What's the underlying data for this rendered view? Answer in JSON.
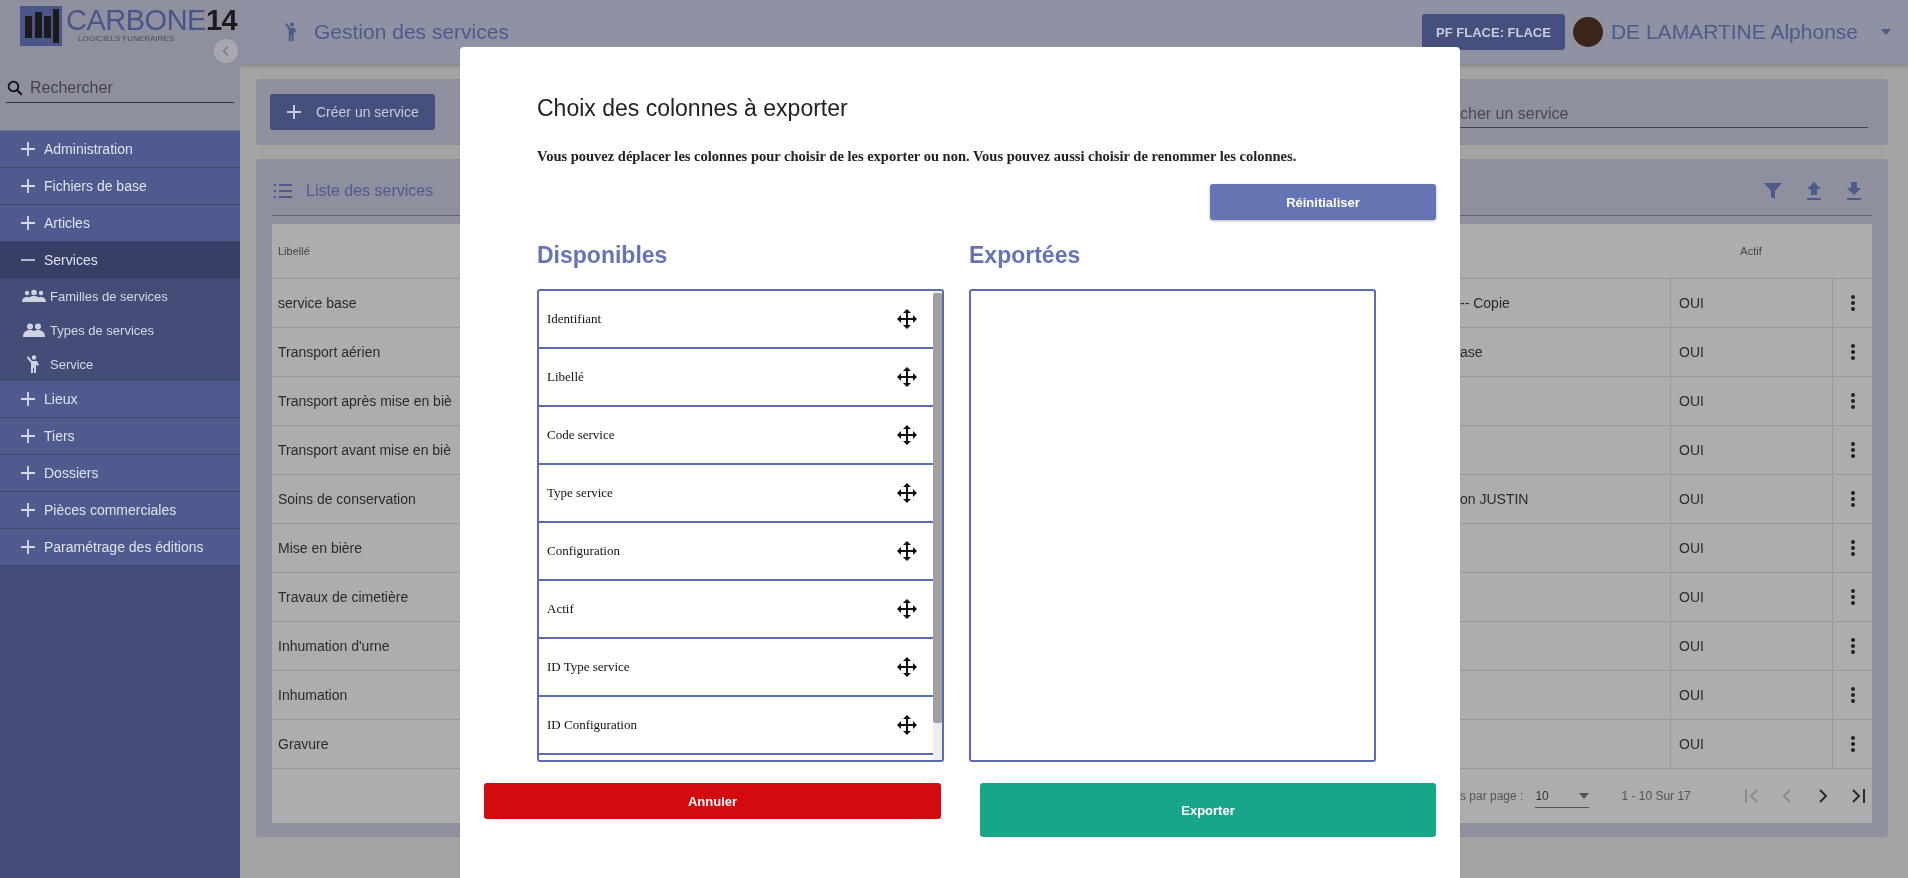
{
  "sidebar": {
    "logo": {
      "name": "CARBONE",
      "number": "14",
      "tagline": "LOGICIELS FUNERAIRES"
    },
    "search": {
      "placeholder": "Rechercher"
    },
    "items": [
      {
        "label": "Administration",
        "expanded": false,
        "selected": false
      },
      {
        "label": "Fichiers de base",
        "expanded": false,
        "selected": false
      },
      {
        "label": "Articles",
        "expanded": false,
        "selected": false
      },
      {
        "label": "Services",
        "expanded": true,
        "selected": true,
        "children": [
          {
            "label": "Familles de services",
            "kind": "group3"
          },
          {
            "label": "Types de services",
            "kind": "group2"
          },
          {
            "label": "Service",
            "kind": "person"
          }
        ]
      },
      {
        "label": "Lieux",
        "expanded": false,
        "selected": false
      },
      {
        "label": "Tiers",
        "expanded": false,
        "selected": false
      },
      {
        "label": "Dossiers",
        "expanded": false,
        "selected": false
      },
      {
        "label": "Pièces commerciales",
        "expanded": false,
        "selected": false
      },
      {
        "label": "Paramétrage des éditions",
        "expanded": false,
        "selected": false
      }
    ]
  },
  "header": {
    "title": "Gestion des services",
    "site_button": "PF FLACE: FLACE",
    "user": "DE LAMARTINE Alphonse"
  },
  "toolbar": {
    "create_button": "Créer un service",
    "search": {
      "placeholder": "cher un service"
    }
  },
  "list": {
    "title": "Liste des services",
    "columns": [
      "Libellé",
      "Actif"
    ],
    "rows": [
      {
        "label": "service base",
        "column_2": "-- Copie",
        "actif": "OUI"
      },
      {
        "label": "Transport aérien",
        "column_2": "ase",
        "actif": "OUI"
      },
      {
        "label": "Transport après mise en biè",
        "actif": "OUI"
      },
      {
        "label": "Transport avant mise en biè",
        "actif": "OUI"
      },
      {
        "label": "Soins de conservation",
        "column_2": "on JUSTIN",
        "actif": "OUI"
      },
      {
        "label": "Mise en bière",
        "actif": "OUI"
      },
      {
        "label": "Travaux de cimetière",
        "actif": "OUI"
      },
      {
        "label": "Inhumation d'urne",
        "actif": "OUI"
      },
      {
        "label": "Inhumation",
        "actif": "OUI"
      },
      {
        "label": "Gravure",
        "actif": "OUI"
      }
    ],
    "pagination": {
      "per_page_label": "s par page :",
      "per_page": "10",
      "range": "1 - 10 Sur 17",
      "nav": [
        {
          "kind": "first",
          "disabled": true
        },
        {
          "kind": "prev",
          "disabled": true
        },
        {
          "kind": "next",
          "disabled": false
        },
        {
          "kind": "last",
          "disabled": false
        }
      ]
    }
  },
  "modal": {
    "title": "Choix des colonnes à exporter",
    "description": "Vous pouvez déplacer les colonnes pour choisir de les exporter ou non. Vous pouvez aussi choisir de renommer les colonnes.",
    "reset_button": "Réinitialiser",
    "available": {
      "title": "Disponibles",
      "items": [
        "Identifiant",
        "Libellé",
        "Code service",
        "Type service",
        "Configuration",
        "Actif",
        "ID Type service",
        "ID Configuration"
      ]
    },
    "exported": {
      "title": "Exportées"
    },
    "cancel_button": "Annuler",
    "export_button": "Exporter"
  }
}
